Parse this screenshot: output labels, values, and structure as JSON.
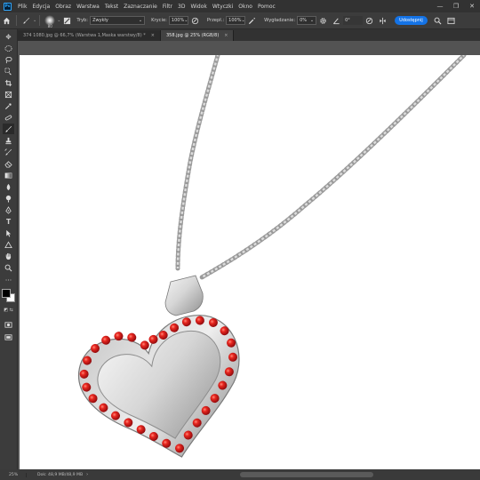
{
  "app": {
    "logo": "Ps"
  },
  "menu": [
    "Plik",
    "Edycja",
    "Obraz",
    "Warstwa",
    "Tekst",
    "Zaznaczanie",
    "Filtr",
    "3D",
    "Widok",
    "Wtyczki",
    "Okno",
    "Pomoc"
  ],
  "window_controls": [
    "—",
    "❐",
    "✕"
  ],
  "options": {
    "brush_size": "80",
    "mode_label": "Tryb:",
    "mode_value": "Zwykły",
    "opacity_label": "Krycie:",
    "opacity_value": "100%",
    "flow_label": "Przepł.:",
    "flow_value": "100%",
    "smoothing_label": "Wygładzanie:",
    "smoothing_value": "0%",
    "angle_value": "0°",
    "share_label": "Udostępnij"
  },
  "tabs": [
    {
      "label": "374 1080.jpg @ 66,7% (Warstwa 1,Maska warstwy/8) *",
      "close": "×"
    },
    {
      "label": "358.jpg @ 25% (RGB/8)",
      "close": "×"
    }
  ],
  "status": {
    "zoom": "25%",
    "doc": "Dok: 48,9 MB/48,9 MB"
  },
  "colors": {
    "accent": "#1473e6",
    "chrome": "#3c3c3c",
    "menubar": "#323232",
    "workspace": "#535353",
    "gem": "#d8171c"
  }
}
